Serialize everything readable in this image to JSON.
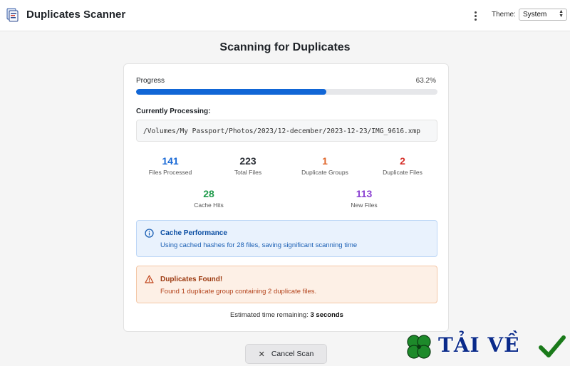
{
  "header": {
    "app_title": "Duplicates Scanner",
    "theme_label": "Theme:",
    "theme_value": "System"
  },
  "page_title": "Scanning for Duplicates",
  "progress": {
    "label": "Progress",
    "percent_text": "63.2%",
    "fraction": 0.632
  },
  "processing": {
    "label": "Currently Processing:",
    "path": "/Volumes/My Passport/Photos/2023/12-december/2023-12-23/IMG_9616.xmp"
  },
  "stats": [
    {
      "value": "141",
      "label": "Files Processed",
      "color": "#1a6ad6"
    },
    {
      "value": "223",
      "label": "Total Files",
      "color": "#2b2f36"
    },
    {
      "value": "1",
      "label": "Duplicate Groups",
      "color": "#e0662a"
    },
    {
      "value": "2",
      "label": "Duplicate Files",
      "color": "#d6302a"
    },
    {
      "value": "28",
      "label": "Cache Hits",
      "color": "#1e9a4a"
    },
    {
      "value": "113",
      "label": "New Files",
      "color": "#8a3fd1"
    }
  ],
  "cache_panel": {
    "title": "Cache Performance",
    "description": "Using cached hashes for 28 files, saving significant scanning time"
  },
  "duplicates_panel": {
    "title": "Duplicates Found!",
    "description": "Found 1 duplicate group containing 2 duplicate files."
  },
  "eta": {
    "prefix": "Estimated time remaining:",
    "value": "3 seconds"
  },
  "cancel_button": {
    "icon": "close-icon",
    "label": "Cancel Scan"
  },
  "watermark": {
    "text": "TẢI VỀ"
  },
  "colors": {
    "accent": "#1166d6",
    "info_bg": "#e9f2fd",
    "warn_bg": "#fdf0e6"
  }
}
